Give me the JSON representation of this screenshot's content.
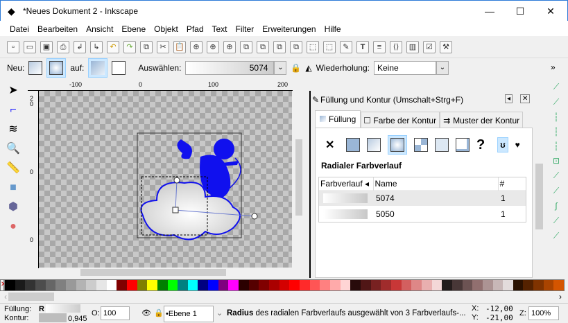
{
  "window": {
    "title": "*Neues Dokument 2 - Inkscape",
    "minimize": "—",
    "maximize": "☐",
    "close": "✕"
  },
  "menu": [
    "Datei",
    "Bearbeiten",
    "Ansicht",
    "Ebene",
    "Objekt",
    "Pfad",
    "Text",
    "Filter",
    "Erweiterungen",
    "Hilfe"
  ],
  "controls": {
    "new_label": "Neu:",
    "on_label": "auf:",
    "select_label": "Auswählen:",
    "select_value": "5074",
    "repeat_label": "Wiederholung:",
    "repeat_value": "Keine",
    "more": "»"
  },
  "ruler": {
    "h": [
      "-100",
      "0",
      "100",
      "200"
    ],
    "v": [
      "2",
      "0",
      "0",
      "0"
    ]
  },
  "panel": {
    "title": "Füllung und Kontur (Umschalt+Strg+F)",
    "tabs": [
      "Füllung",
      "Farbe der Kontur",
      "Muster der Kontur"
    ],
    "fill_type": "Radialer Farbverlauf",
    "columns": [
      "Farbverlauf",
      "Name",
      "#"
    ],
    "rows": [
      {
        "name": "5074",
        "count": "1"
      },
      {
        "name": "5050",
        "count": "1"
      }
    ]
  },
  "palette": [
    "#000000",
    "#1a1a1a",
    "#333333",
    "#4d4d4d",
    "#666666",
    "#808080",
    "#999999",
    "#b3b3b3",
    "#cccccc",
    "#e6e6e6",
    "#ffffff",
    "#800000",
    "#ff0000",
    "#808000",
    "#ffff00",
    "#008000",
    "#00ff00",
    "#008080",
    "#00ffff",
    "#000080",
    "#0000ff",
    "#800080",
    "#ff00ff",
    "#2b0000",
    "#550000",
    "#800000",
    "#aa0000",
    "#d40000",
    "#ff0000",
    "#ff2a2a",
    "#ff5555",
    "#ff8080",
    "#ffaaaa",
    "#ffd5d5",
    "#280b0b",
    "#501616",
    "#782121",
    "#a02c2c",
    "#c83737",
    "#d35f5f",
    "#de8787",
    "#e9afaf",
    "#f4d7d7",
    "#241c1c",
    "#483737",
    "#6c5353",
    "#916f6f",
    "#ac9393",
    "#c8b7b7",
    "#e3dbdb",
    "#2b1100",
    "#552200",
    "#803300",
    "#aa4400",
    "#d45500"
  ],
  "status": {
    "fill_label": "Füllung:",
    "fill_value": "R",
    "stroke_label": "Kontur:",
    "stroke_value": "0,945",
    "opacity_label": "O:",
    "opacity_value": "100",
    "layer": "•Ebene 1",
    "message_bold": "Radius",
    "message": " des radialen Farbverlaufs ausgewählt von 3 Farbverlaufs-...",
    "x_label": "X:",
    "x_value": "-12,00",
    "y_label": "Y:",
    "y_value": "-21,00",
    "zoom_label": "Z:",
    "zoom_value": "100%"
  }
}
